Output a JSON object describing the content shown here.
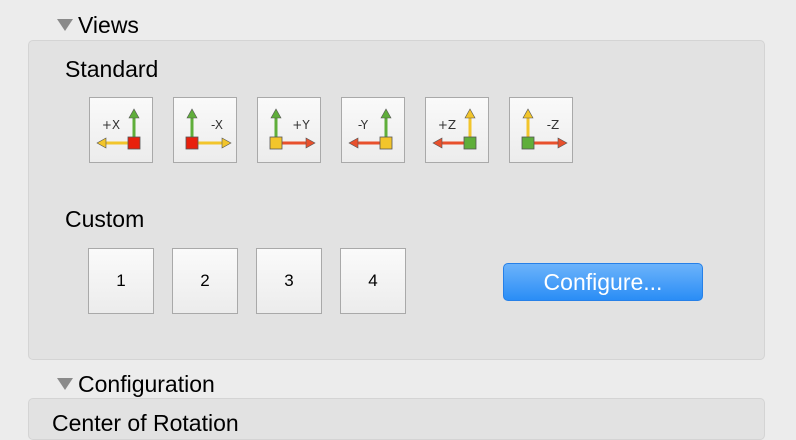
{
  "views": {
    "title": "Views",
    "standard_label": "Standard",
    "custom_label": "Custom",
    "standard_buttons": [
      {
        "label": "+X",
        "square_color": "#e8200c",
        "horizontal_arrow": "left",
        "horizontal_color": "#f2c52b",
        "vertical_color": "#5fae3a",
        "label_side": "left"
      },
      {
        "label": "-X",
        "square_color": "#e8200c",
        "horizontal_arrow": "right",
        "horizontal_color": "#f2c52b",
        "vertical_color": "#5fae3a",
        "label_side": "right"
      },
      {
        "label": "+Y",
        "square_color": "#f2c52b",
        "horizontal_arrow": "right",
        "horizontal_color": "#e8502c",
        "vertical_color": "#5fae3a",
        "label_side": "right"
      },
      {
        "label": "-Y",
        "square_color": "#f2c52b",
        "horizontal_arrow": "left",
        "horizontal_color": "#e8502c",
        "vertical_color": "#5fae3a",
        "label_side": "left"
      },
      {
        "label": "+Z",
        "square_color": "#5fae3a",
        "horizontal_arrow": "left",
        "horizontal_color": "#e8502c",
        "vertical_color": "#f2c52b",
        "label_side": "left"
      },
      {
        "label": "-Z",
        "square_color": "#5fae3a",
        "horizontal_arrow": "right",
        "horizontal_color": "#e8502c",
        "vertical_color": "#f2c52b",
        "label_side": "right"
      }
    ],
    "custom_buttons": [
      "1",
      "2",
      "3",
      "4"
    ],
    "configure_label": "Configure..."
  },
  "configuration": {
    "title": "Configuration",
    "center_label": "Center of Rotation"
  },
  "colors": {
    "accent": "#2a8df6"
  }
}
